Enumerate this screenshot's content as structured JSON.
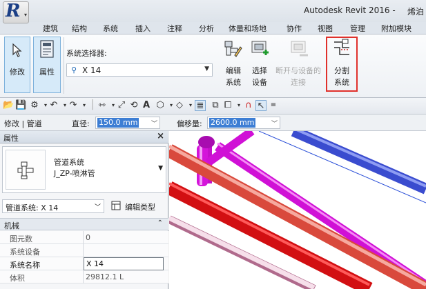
{
  "app": {
    "title": "Autodesk Revit 2016 -",
    "title_extra": "烯泊"
  },
  "ribbon_tabs": [
    "建筑",
    "结构",
    "系统",
    "插入",
    "注释",
    "分析",
    "体量和场地",
    "协作",
    "视图",
    "管理",
    "附加模块"
  ],
  "ribbon": {
    "modify_label": "修改",
    "properties_label": "属性",
    "selector_label": "系统选择器:",
    "selector_value": "X 14",
    "edit_system": [
      "编辑",
      "系统"
    ],
    "select_equipment": [
      "选择",
      "设备"
    ],
    "disconnect": [
      "断开与设备的",
      "连接"
    ],
    "split_system": [
      "分割",
      "系统"
    ]
  },
  "options_bar": {
    "context": "修改 | 管道",
    "diameter_label": "直径:",
    "diameter_value": "150.0 mm",
    "offset_label": "偏移量:",
    "offset_value": "2600.0 mm"
  },
  "properties": {
    "title": "属性",
    "close": "×",
    "type_name": "管道系统",
    "type_sub": "J_ZP-喷淋管",
    "type_dropdown": "管道系统: X 14",
    "edit_type": "编辑类型",
    "category": "机械",
    "category_chevron": "⌃",
    "rows": [
      {
        "name": "图元数",
        "value": "0"
      },
      {
        "name": "系统设备",
        "value": ""
      },
      {
        "name": "系统名称",
        "value": "X 14"
      },
      {
        "name": "体积",
        "value": "29812.1 L"
      }
    ]
  },
  "colors": {
    "highlight": "#e0302b",
    "selection": "#3d7ed4",
    "pipe_magenta": "#e818e8",
    "pipe_red": "#e81818",
    "pipe_salmon": "#f07062",
    "pipe_blue": "#5c6ee6"
  },
  "icons": [
    "cursor-arrow-icon",
    "properties-icon",
    "pipe-type-icon",
    "edit-system-icon",
    "select-equipment-icon",
    "disconnect-icon",
    "split-system-icon",
    "open-icon",
    "save-icon",
    "undo-icon",
    "redo-icon",
    "measure-icon",
    "text-icon",
    "close-icon"
  ]
}
